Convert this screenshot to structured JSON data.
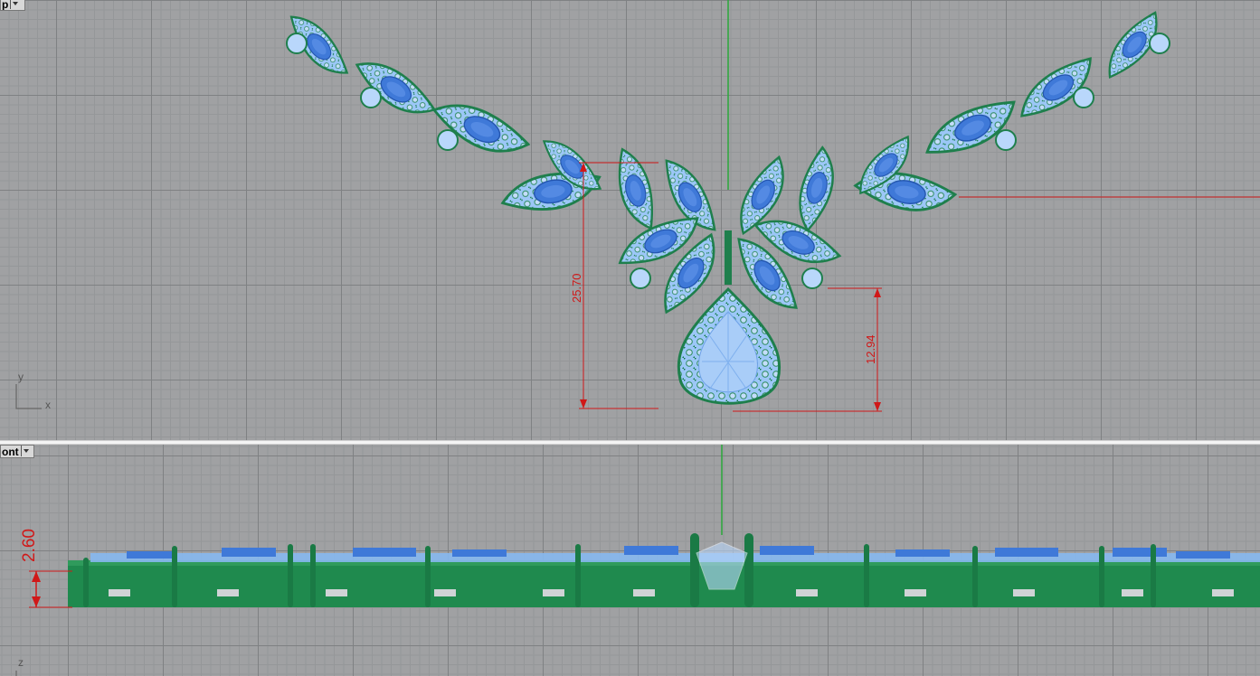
{
  "viewports": {
    "top": {
      "name": "p",
      "axis_x": "x",
      "axis_y": "y"
    },
    "front": {
      "name": "ont",
      "axis_z": "z"
    }
  },
  "dimensions": {
    "overall_height": "25.70",
    "pendant_height": "12.94",
    "thickness": "2.60"
  },
  "colors": {
    "metal": "#1e7f4c",
    "stone_light": "#8fc0f5",
    "stone_main": "#3f79d8",
    "dimension": "#d01818",
    "axis_green": "#2aa83a",
    "axis_red": "#c03030"
  },
  "icons": {
    "cplane_axes": "xy-axes-icon",
    "viewport_menu": "chevron-down-icon"
  }
}
